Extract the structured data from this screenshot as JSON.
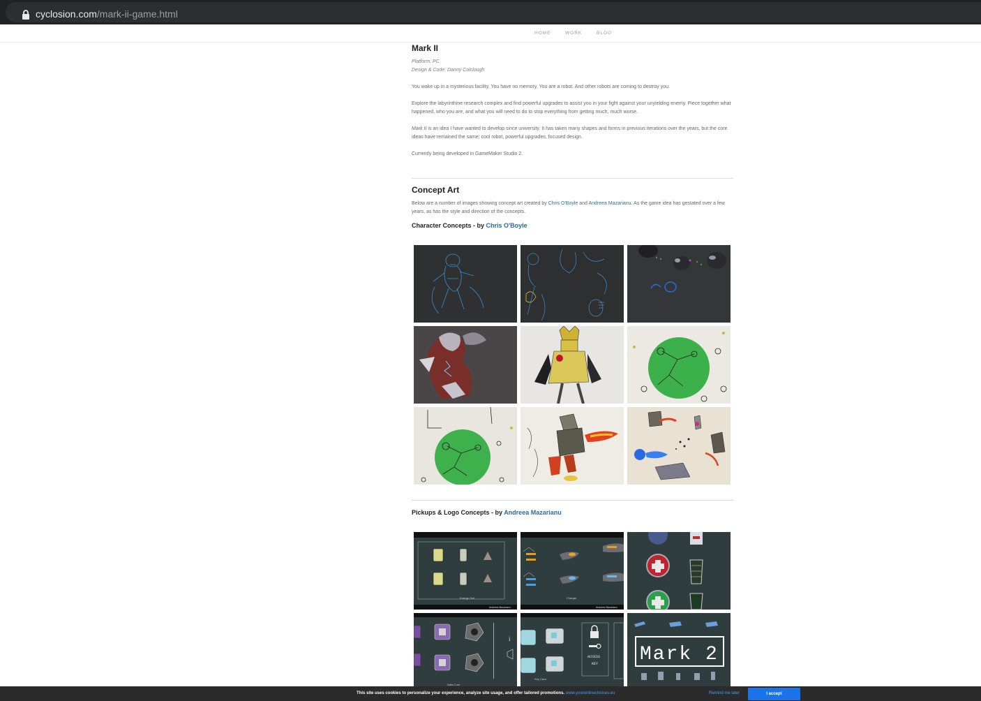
{
  "browser": {
    "domain": "cyclosion.com",
    "path": "/mark-ii-game.html"
  },
  "nav": {
    "items": [
      "HOME",
      "WORK",
      "BLOG"
    ]
  },
  "game": {
    "title": "Mark II",
    "platform": "Platform: PC",
    "credits": "Design & Code: Danny Colclough",
    "para1": "You wake up in a mysterious facility. You have no memory. You are a robot. And other robots are coming to destroy you.",
    "para2": "Explore the labyrinthine research complex and find powerful upgrades to assist you in your fight against your unyielding enemy. Piece together what happened, who you are, and what you will need to do to stop everything from getting much, much worse.",
    "para3_em": "Mark II",
    "para3_rest": " is an idea I have wanted to develop since university. It has taken many shapes and forms in previous iterations over the years, but the core ideas have remained the same; cool robot, powerful upgrades, focused design.",
    "para4": "Currently being developed in GameMaker Studio 2."
  },
  "concept": {
    "title": "Concept Art",
    "intro_a": "Below are a number of images showing concept art created by ",
    "artist1": "Chris O'Boyle",
    "intro_b": " and ",
    "artist2": "Andreea Mazarianu",
    "intro_c": ". As the game idea has gestated over a few years, as has the style and direction of the concepts.",
    "character_heading": "Character Concepts - by ",
    "pickups_heading": "Pickups & Logo Concepts - by "
  },
  "pickup_labels": {
    "energy": "Energy Cell",
    "charger": "Charger",
    "data_core": "Data Core",
    "key_card": "Key Card",
    "access": "ACCESS",
    "key": "KEY",
    "logo": "Mark 2",
    "signature": "Andreea Mazarianu"
  },
  "cookie": {
    "message": "This site uses cookies to personalize your experience, analyze site usage, and offer tailored promotions.",
    "link": "www.youronlinechoices.eu",
    "remind": "Remind me later",
    "accept": "I accept"
  },
  "colors": {
    "link": "#2d6a9f",
    "accept": "#1a73e8",
    "chrome": "#202124"
  }
}
